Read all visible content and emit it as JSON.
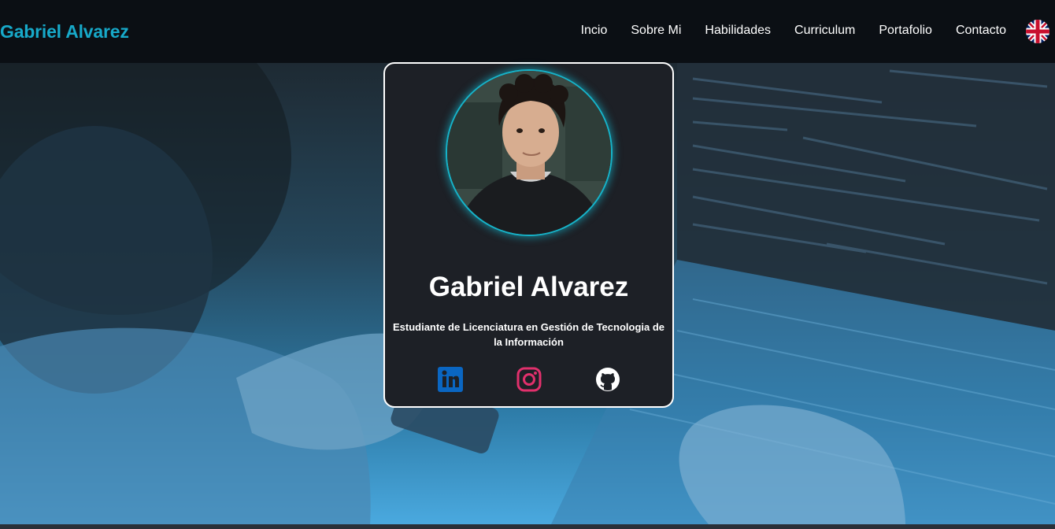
{
  "header": {
    "brand": "Gabriel Alvarez",
    "nav": [
      "Incio",
      "Sobre Mi",
      "Habilidades",
      "Curriculum",
      "Portafolio",
      "Contacto"
    ],
    "language_icon": "uk-flag-icon"
  },
  "profile": {
    "name": "Gabriel Alvarez",
    "role": "Estudiante de Licenciatura en Gestión de Tecnologia de la Información",
    "socials": [
      {
        "icon": "linkedin-icon",
        "color": "#0a66c2"
      },
      {
        "icon": "instagram-icon",
        "color": "#e1306c"
      },
      {
        "icon": "github-icon",
        "color": "#ffffff"
      }
    ]
  },
  "colors": {
    "accent": "#17a9c9",
    "header_bg": "#0b0f14",
    "card_bg": "#1d2026"
  }
}
